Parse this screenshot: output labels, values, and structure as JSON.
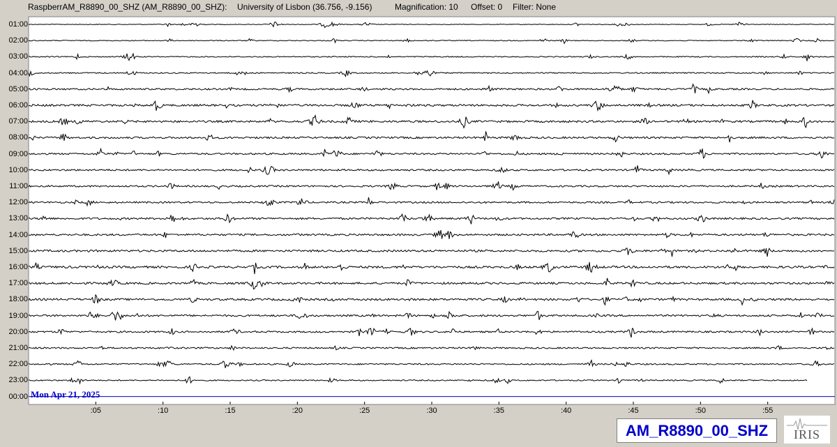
{
  "header": {
    "station": "RaspberrAM_R8890_00_SHZ (AM_R8890_00_SHZ):",
    "location": "University of Lisbon (36.756, -9.156)",
    "magnification": "Magnification: 10",
    "offset": "Offset: 0",
    "filter": "Filter: None"
  },
  "chart_data": {
    "type": "line",
    "rows": [
      "01:00",
      "02:00",
      "03:00",
      "04:00",
      "05:00",
      "06:00",
      "07:00",
      "08:00",
      "09:00",
      "10:00",
      "11:00",
      "12:00",
      "13:00",
      "14:00",
      "15:00",
      "16:00",
      "17:00",
      "18:00",
      "19:00",
      "20:00",
      "21:00",
      "22:00",
      "23:00",
      "00:00"
    ],
    "x_ticks": [
      ":05",
      ":10",
      ":15",
      ":20",
      ":25",
      ":30",
      ":35",
      ":40",
      ":45",
      ":50",
      ":55"
    ],
    "x_tick_minutes": [
      5,
      10,
      15,
      20,
      25,
      30,
      35,
      40,
      45,
      50,
      55
    ],
    "xlim": [
      0,
      60
    ],
    "noise_level": [
      0.4,
      0.5,
      0.6,
      0.7,
      1.0,
      1.2,
      1.2,
      1.1,
      1.0,
      1.0,
      1.0,
      1.0,
      1.1,
      1.1,
      1.2,
      1.3,
      1.2,
      1.2,
      1.1,
      1.0,
      0.9,
      0.8,
      0.7,
      0
    ],
    "series_color": "#000000",
    "last_row_color": "#0000cc",
    "grid": false
  },
  "footer": {
    "date": "Mon Apr 21, 2025",
    "station_code": "AM_R8890_00_SHZ",
    "logo": "IRIS"
  }
}
